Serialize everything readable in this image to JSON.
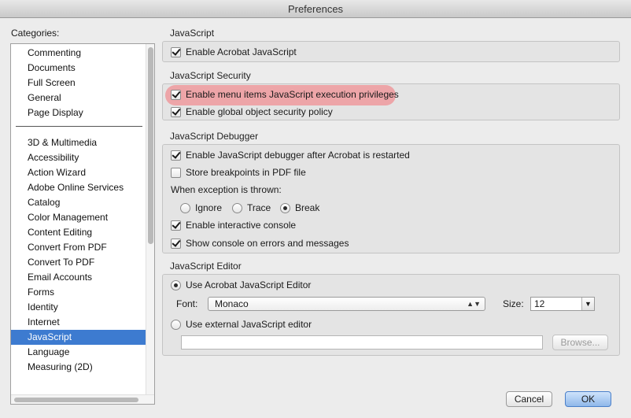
{
  "window": {
    "title": "Preferences"
  },
  "categories": {
    "label": "Categories:",
    "top_items": [
      "Commenting",
      "Documents",
      "Full Screen",
      "General",
      "Page Display"
    ],
    "items": [
      "3D & Multimedia",
      "Accessibility",
      "Action Wizard",
      "Adobe Online Services",
      "Catalog",
      "Color Management",
      "Content Editing",
      "Convert From PDF",
      "Convert To PDF",
      "Email Accounts",
      "Forms",
      "Identity",
      "Internet",
      "JavaScript",
      "Language",
      "Measuring (2D)"
    ],
    "selected": "JavaScript"
  },
  "javascript": {
    "title": "JavaScript",
    "enable_label": "Enable Acrobat JavaScript",
    "enable_checked": true
  },
  "security": {
    "title": "JavaScript Security",
    "menu_items_label": "Enable menu items JavaScript execution privileges",
    "menu_items_checked": true,
    "global_policy_label": "Enable global object security policy",
    "global_policy_checked": true
  },
  "debugger": {
    "title": "JavaScript Debugger",
    "enable_debugger_label": "Enable JavaScript debugger after Acrobat is restarted",
    "enable_debugger_checked": true,
    "store_breakpoints_label": "Store breakpoints in PDF file",
    "store_breakpoints_checked": false,
    "exception_label": "When exception is thrown:",
    "exception_options": [
      "Ignore",
      "Trace",
      "Break"
    ],
    "exception_selected": "Break",
    "interactive_console_label": "Enable interactive console",
    "interactive_console_checked": true,
    "show_console_label": "Show console on errors and messages",
    "show_console_checked": true
  },
  "editor": {
    "title": "JavaScript Editor",
    "use_acrobat_label": "Use Acrobat JavaScript Editor",
    "use_acrobat_selected": true,
    "font_label": "Font:",
    "font_value": "Monaco",
    "size_label": "Size:",
    "size_value": "12",
    "use_external_label": "Use external JavaScript editor",
    "external_path": "",
    "browse_label": "Browse..."
  },
  "footer": {
    "cancel_label": "Cancel",
    "ok_label": "OK"
  },
  "icons": {
    "check": "checkmark-icon",
    "radio": "radio-dot-icon",
    "updown": "updown-arrows-icon",
    "dropdown": "chevron-down-icon"
  }
}
